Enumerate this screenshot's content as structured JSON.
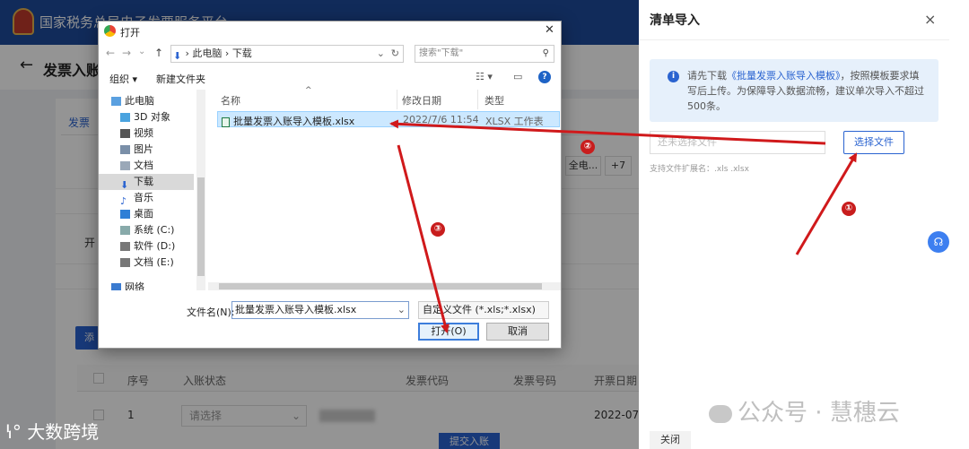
{
  "app": {
    "header_title": "国家税务总局电子发票服务平台",
    "page_title": "发票入账",
    "tab_label": "发票",
    "btn_all": "全电...",
    "btn_plus": "+7",
    "label_kai": "开",
    "btn_primary": "添",
    "table_headers": [
      "序号",
      "入账状态",
      "发票代码",
      "发票号码",
      "开票日期"
    ],
    "row1": {
      "index": "1",
      "status_placeholder": "请选择",
      "date": "2022-07-"
    },
    "submit_label": "提交入账"
  },
  "panel": {
    "title": "清单导入",
    "close_icon": "×",
    "info_prefix": "请先下载",
    "info_link": "《批量发票入账导入模板》",
    "info_suffix": "，按照模板要求填写后上传。为保障导入数据流畅，建议单次导入不超过500条。",
    "file_placeholder": "还未选择文件",
    "choose_button": "选择文件",
    "ext_hint": "支持文件扩展名：.xls .xlsx",
    "close_button": "关闭"
  },
  "dialog": {
    "title": "打开",
    "breadcrumb": [
      "此电脑",
      "下载"
    ],
    "search_placeholder": "搜索\"下载\"",
    "organize": "组织 ▾",
    "new_folder": "新建文件夹",
    "tree": [
      "此电脑",
      "3D 对象",
      "视频",
      "图片",
      "文档",
      "下载",
      "音乐",
      "桌面",
      "系统 (C:)",
      "软件 (D:)",
      "文档 (E:)",
      "网络"
    ],
    "columns": {
      "name": "名称",
      "modified": "修改日期",
      "type": "类型"
    },
    "files": [
      {
        "name": "批量发票入账导入模板.xlsx",
        "modified": "2022/7/6 11:54",
        "type": "XLSX 工作表"
      }
    ],
    "filename_label": "文件名(N):",
    "filename_value": "批量发票入账导入模板.xlsx",
    "filetype_value": "自定义文件 (*.xls;*.xlsx)",
    "open_button": "打开(O)",
    "cancel_button": "取消"
  },
  "annotations": [
    "①",
    "②",
    "③"
  ],
  "watermarks": {
    "right": "公众号 · 慧穗云",
    "left": "大数跨境"
  },
  "colors": {
    "brand_blue": "#2a63d0",
    "arrow_red": "#d0191b"
  }
}
